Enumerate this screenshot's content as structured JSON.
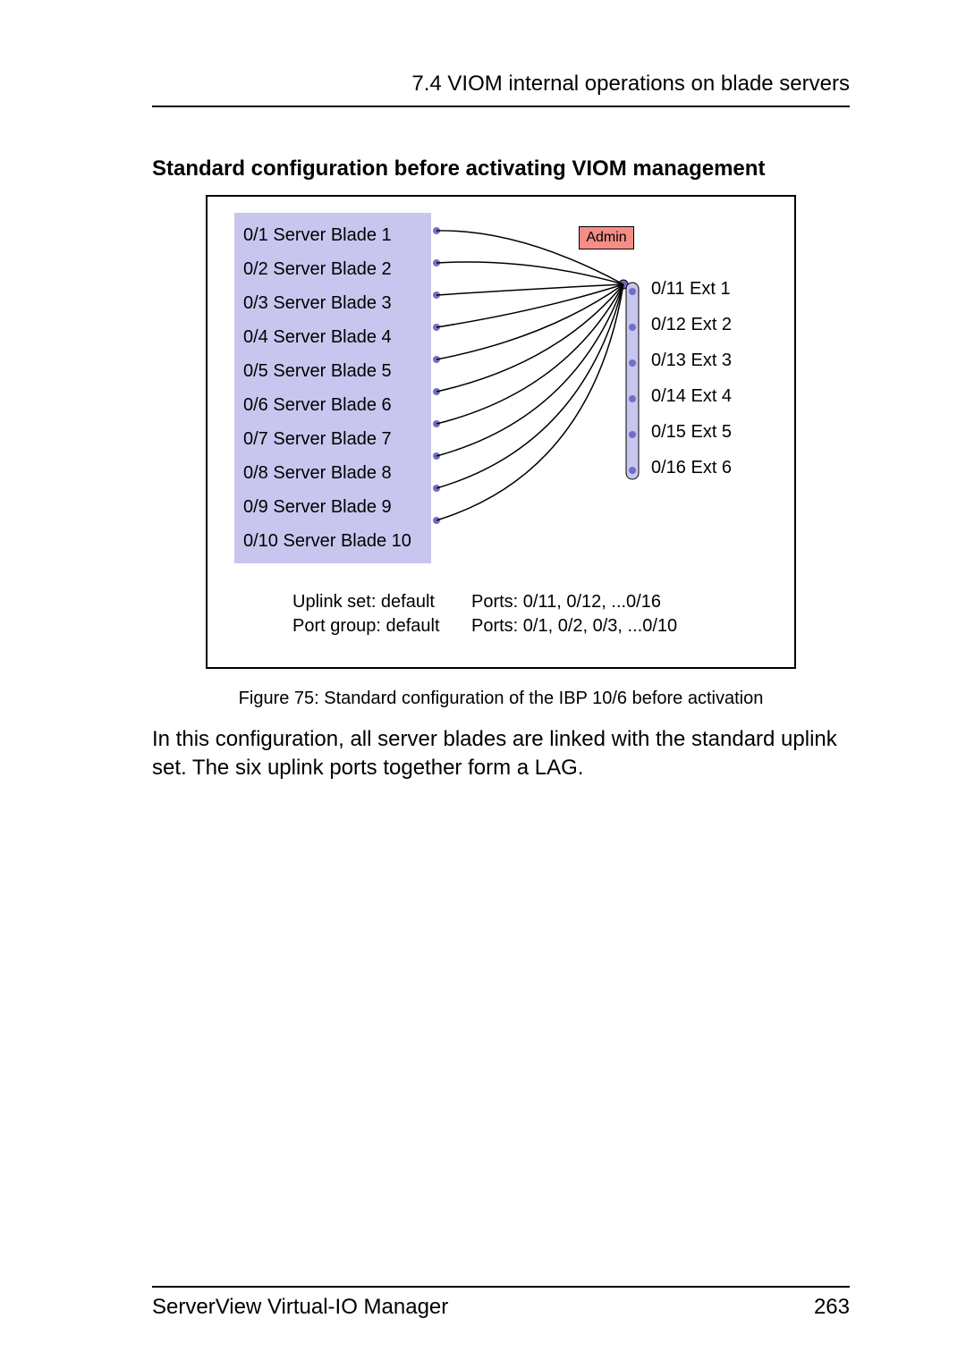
{
  "header": {
    "section_ref": "7.4 VIOM internal operations on blade servers"
  },
  "section_title": "Standard configuration before activating VIOM management",
  "diagram": {
    "blades": [
      "0/1 Server Blade 1",
      "0/2 Server Blade 2",
      "0/3 Server Blade 3",
      "0/4 Server Blade 4",
      "0/5 Server Blade 5",
      "0/6 Server Blade 6",
      "0/7 Server Blade 7",
      "0/8 Server Blade 8",
      "0/9 Server Blade 9",
      "0/10 Server Blade 10"
    ],
    "ext_ports": [
      "0/11 Ext 1",
      "0/12 Ext 2",
      "0/13 Ext 3",
      "0/14 Ext 4",
      "0/15 Ext 5",
      "0/16 Ext 6"
    ],
    "admin_label": "Admin",
    "legend": {
      "row1_label": "Uplink set: default",
      "row1_ports": "Ports: 0/11, 0/12, ...0/16",
      "row2_label": "Port group: default",
      "row2_ports": "Ports: 0/1, 0/2, 0/3, ...0/10"
    }
  },
  "caption": "Figure 75: Standard configuration of the IBP 10/6 before activation",
  "body_text": "In this configuration, all server blades are linked with the standard uplink set. The six uplink ports together form a LAG.",
  "footer": {
    "doc_title": "ServerView Virtual-IO Manager",
    "page_no": "263"
  },
  "chart_data": {
    "type": "diagram",
    "note": "Network connection diagram: each server blade internal port (0/1..0/10) fans into a single aggregation point which is linked to external LAG ports (0/11..0/16).",
    "left_nodes": [
      "0/1",
      "0/2",
      "0/3",
      "0/4",
      "0/5",
      "0/6",
      "0/7",
      "0/8",
      "0/9",
      "0/10"
    ],
    "right_nodes": [
      "0/11",
      "0/12",
      "0/13",
      "0/14",
      "0/15",
      "0/16"
    ],
    "hub_label": "Admin",
    "edges": [
      [
        "0/1",
        "hub"
      ],
      [
        "0/2",
        "hub"
      ],
      [
        "0/3",
        "hub"
      ],
      [
        "0/4",
        "hub"
      ],
      [
        "0/5",
        "hub"
      ],
      [
        "0/6",
        "hub"
      ],
      [
        "0/7",
        "hub"
      ],
      [
        "0/8",
        "hub"
      ],
      [
        "0/9",
        "hub"
      ],
      [
        "0/10",
        "hub"
      ],
      [
        "hub",
        "0/11"
      ],
      [
        "hub",
        "0/12"
      ],
      [
        "hub",
        "0/13"
      ],
      [
        "hub",
        "0/14"
      ],
      [
        "hub",
        "0/15"
      ],
      [
        "hub",
        "0/16"
      ]
    ]
  }
}
